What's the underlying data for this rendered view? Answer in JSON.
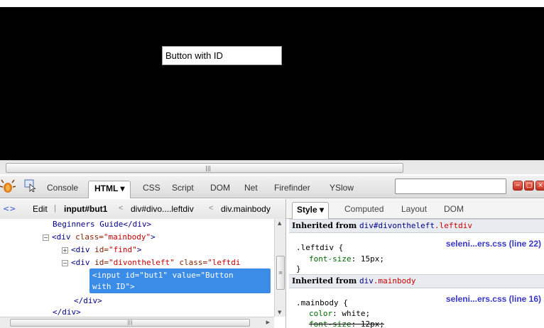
{
  "page": {
    "button_value": "Button with ID"
  },
  "firebug": {
    "tabs": [
      "Console",
      "HTML ▾",
      "CSS",
      "Script",
      "DOM",
      "Net",
      "Firefinder",
      "YSlow"
    ],
    "search_placeholder": "",
    "window_buttons": [
      "−",
      "▢",
      "×"
    ]
  },
  "breadcrumb": {
    "edit_label": "Edit",
    "items": [
      "input#but1",
      "div#divo....leftdiv",
      "div.mainbody"
    ],
    "separator": "<"
  },
  "side_tabs": [
    "Style ▾",
    "Computed",
    "Layout",
    "DOM"
  ],
  "tree": {
    "lines": [
      {
        "text": "Beginners Guide</div>"
      },
      {
        "open": "<div ",
        "attr": "class=",
        "val": "\"mainbody\"",
        "close": ">"
      },
      {
        "open": "<div ",
        "attr": "id=",
        "val": "\"find\"",
        "close": ">"
      },
      {
        "open": "<div ",
        "attr": "id=",
        "val": "\"divontheleft\"",
        "attr2": " class=",
        "val2": "\"leftdi"
      },
      {
        "text": "</div>"
      },
      {
        "text": "</div>"
      }
    ],
    "selected": "<input id=\"but1\" value=\"Button\nwith ID\">"
  },
  "style": {
    "groups": [
      {
        "heading": "Inherited from ",
        "sel_tag": "div#divontheleft",
        "sel_class": ".leftdiv",
        "selector": ".leftdiv {",
        "source": "seleni...ers.css (line 22)",
        "props": [
          {
            "name": "font-size",
            "value": "15px;"
          }
        ],
        "close": "}"
      },
      {
        "heading": "Inherited from ",
        "sel_tag": "div",
        "sel_class": ".mainbody",
        "selector": ".mainbody {",
        "source": "seleni...ers.css (line 16)",
        "props": [
          {
            "name": "color",
            "value": "white;"
          },
          {
            "name": "font-size",
            "value": "12px;"
          }
        ]
      }
    ]
  },
  "colors": {
    "page_bg": "#000000",
    "selection": "#3a8ce6",
    "tag": "#000088",
    "attr_value": "#cc0000",
    "link": "#3737c8"
  }
}
